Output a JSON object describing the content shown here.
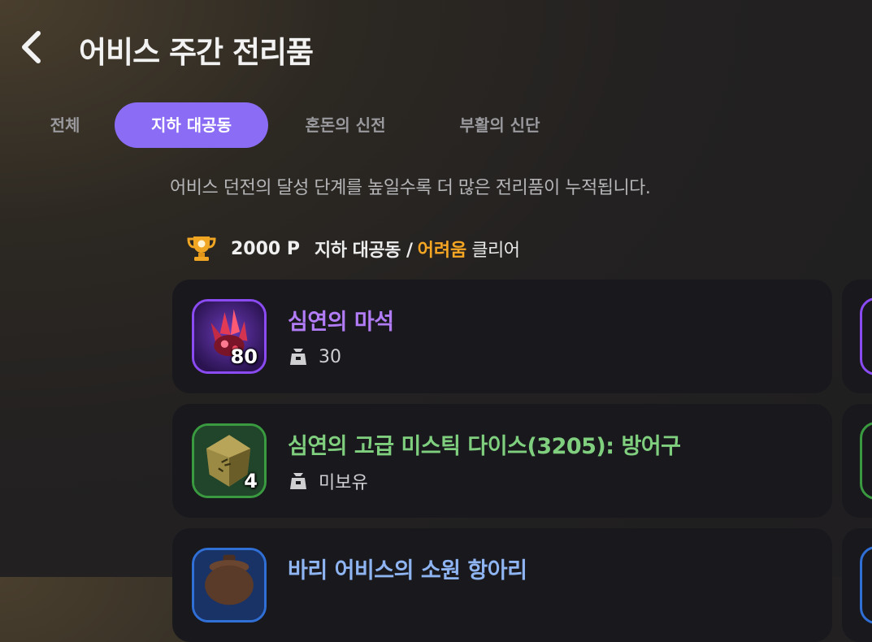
{
  "header": {
    "title": "어비스 주간 전리품",
    "back_icon": "chevron-left-icon"
  },
  "tabs": [
    {
      "label": "전체",
      "active": false
    },
    {
      "label": "지하 대공동",
      "active": true
    },
    {
      "label": "혼돈의 신전",
      "active": false
    },
    {
      "label": "부활의 신단",
      "active": false
    }
  ],
  "description": "어비스 던전의 달성 단계를 높일수록 더 많은 전리품이 누적됩니다.",
  "reward": {
    "icon": "trophy-icon",
    "points": "2000 P",
    "condition_prefix": "지하 대공동 /",
    "difficulty": "어려움",
    "condition_suffix": "클리어"
  },
  "items": [
    {
      "name": "심연의 마석",
      "quantity": "80",
      "owned": "30",
      "grade_color": "#8a4bf2",
      "name_color": "#b27cf7",
      "icon": "red-crystal-icon"
    },
    {
      "name": "심연의 고급 미스틱 다이스(3205): 방어구",
      "quantity": "4",
      "owned": "미보유",
      "grade_color": "#3a9a40",
      "name_color": "#7fcf7f",
      "icon": "rune-dice-icon"
    },
    {
      "name": "바리 어비스의 소원 항아리",
      "quantity": "",
      "owned": "",
      "grade_color": "#2f6fd6",
      "name_color": "#8fb4f2",
      "icon": "jar-icon"
    }
  ],
  "colors": {
    "accent": "#8b6cf5",
    "difficulty": "#f5a623",
    "card_bg": "#18181d"
  }
}
